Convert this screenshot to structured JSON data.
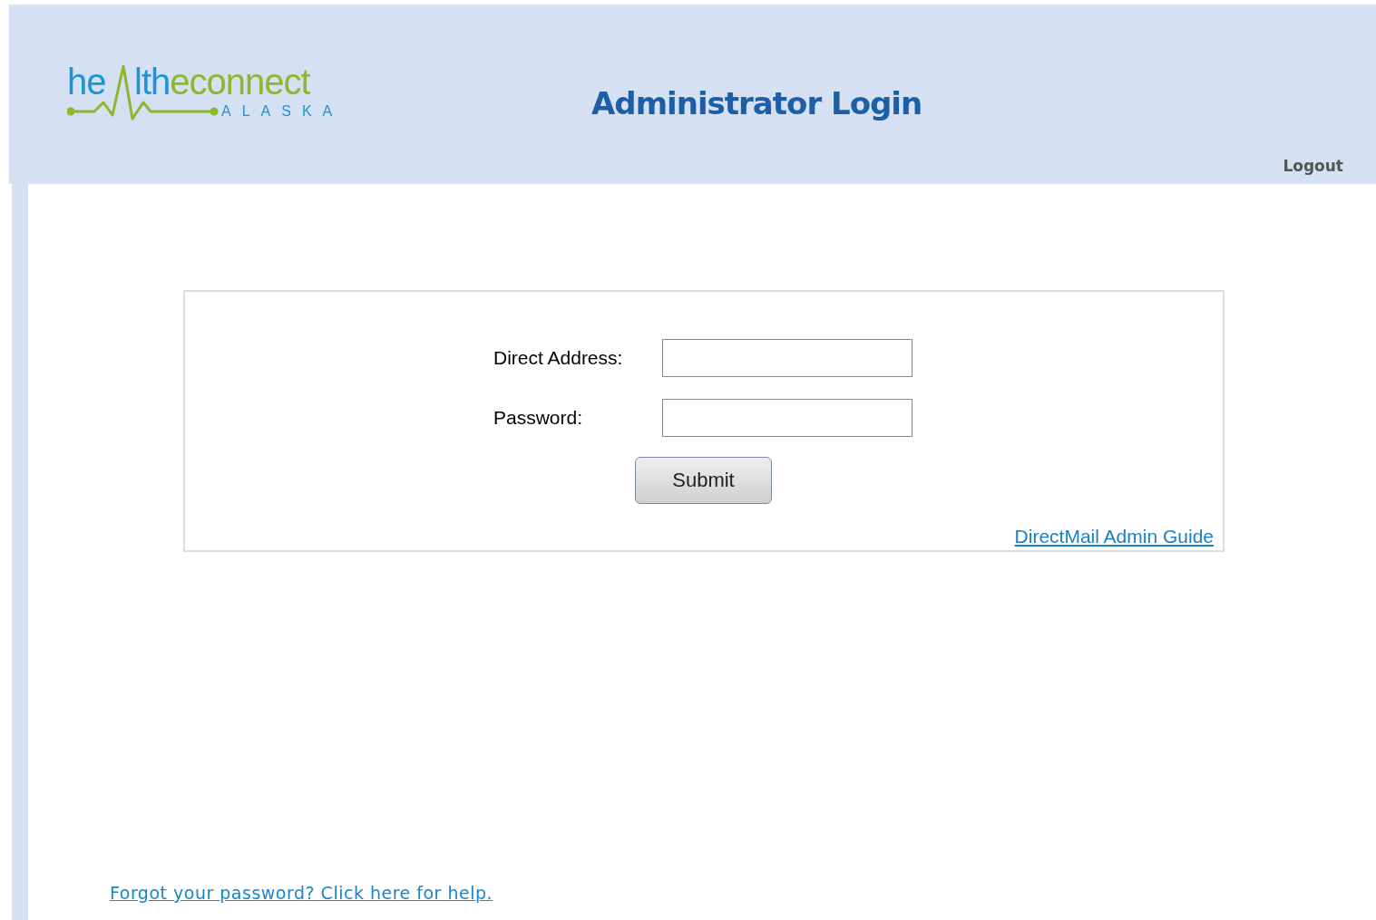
{
  "logo": {
    "wordmark_start": "he",
    "wordmark_middle": "lth",
    "wordmark_end": "econnect",
    "tagline": "ALASKA"
  },
  "header": {
    "title": "Administrator Login",
    "logout": "Logout"
  },
  "form": {
    "fields": [
      {
        "label": "Direct Address:"
      },
      {
        "label": "Password:"
      }
    ],
    "submit": "Submit",
    "guide_link": "DirectMail Admin Guide"
  },
  "forgot_link": "Forgot your password? Click here for help."
}
